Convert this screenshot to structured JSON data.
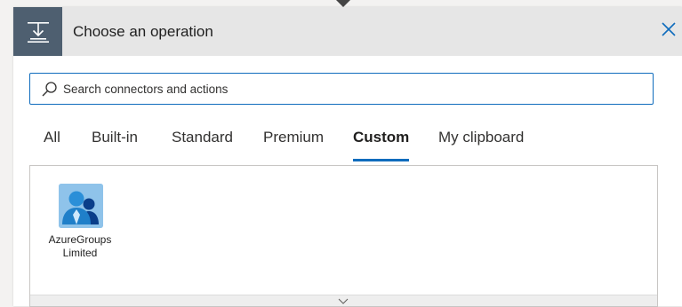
{
  "header": {
    "title": "Choose an operation",
    "icon": "operation-icon",
    "close_icon": "close-icon"
  },
  "search": {
    "placeholder": "Search connectors and actions",
    "value": "",
    "icon": "search-icon"
  },
  "tabs": [
    {
      "label": "All",
      "active": false
    },
    {
      "label": "Built-in",
      "active": false
    },
    {
      "label": "Standard",
      "active": false
    },
    {
      "label": "Premium",
      "active": false
    },
    {
      "label": "Custom",
      "active": true
    },
    {
      "label": "My clipboard",
      "active": false
    }
  ],
  "connectors": [
    {
      "name_line1": "AzureGroups",
      "name_line2": "Limited",
      "icon": "users-icon"
    }
  ],
  "colors": {
    "accent": "#0f6cbd",
    "header_icon_bg": "#4e5f70",
    "header_bg": "#e6e6e6",
    "connector_icon_bg": "#8fc3ea"
  }
}
